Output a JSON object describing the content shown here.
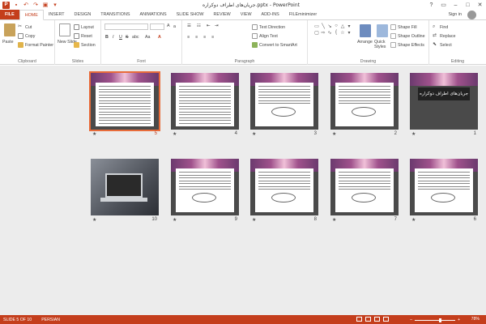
{
  "window": {
    "title": "جریان‌های اطراف دوکراره.pptx - PowerPoint",
    "minimize": "–",
    "maximize": "□",
    "close": "✕"
  },
  "tabs": [
    "FILE",
    "HOME",
    "INSERT",
    "DESIGN",
    "TRANSITIONS",
    "ANIMATIONS",
    "SLIDE SHOW",
    "REVIEW",
    "VIEW",
    "ADD-INS",
    "FILEminimizer"
  ],
  "account": {
    "signin": "Sign in"
  },
  "ribbon": {
    "clipboard": {
      "label": "Clipboard",
      "paste": "Paste",
      "cut": "Cut",
      "copy": "Copy",
      "format_painter": "Format Painter"
    },
    "slides": {
      "label": "Slides",
      "new_slide": "New Slide",
      "layout": "Layout",
      "reset": "Reset",
      "section": "Section"
    },
    "font": {
      "label": "Font",
      "bold": "B",
      "italic": "I",
      "underline": "U",
      "strike": "S",
      "shadow": "abc",
      "aa": "Aa"
    },
    "paragraph": {
      "label": "Paragraph",
      "text_direction": "Text Direction",
      "align_text": "Align Text",
      "convert_smartart": "Convert to SmartArt"
    },
    "drawing": {
      "label": "Drawing",
      "arrange": "Arrange",
      "quick_styles": "Quick Styles",
      "shape_fill": "Shape Fill",
      "shape_outline": "Shape Outline",
      "shape_effects": "Shape Effects"
    },
    "editing": {
      "label": "Editing",
      "find": "Find",
      "replace": "Replace",
      "select": "Select"
    }
  },
  "slides": [
    {
      "number": "1",
      "title": "جریان‌های اطراف دوکراره",
      "kind": "title"
    },
    {
      "number": "2",
      "kind": "diagram"
    },
    {
      "number": "3",
      "kind": "diagram"
    },
    {
      "number": "4",
      "kind": "text"
    },
    {
      "number": "5",
      "kind": "text",
      "selected": true
    },
    {
      "number": "6",
      "kind": "diagram"
    },
    {
      "number": "7",
      "kind": "diagram"
    },
    {
      "number": "8",
      "kind": "diagram"
    },
    {
      "number": "9",
      "kind": "diagram"
    },
    {
      "number": "10",
      "kind": "photo"
    }
  ],
  "status": {
    "slide_of": "SLIDE 5 OF 10",
    "language": "PERSIAN",
    "zoom": "78%"
  },
  "colors": {
    "accent": "#c43e1c",
    "selection": "#e86b3a"
  }
}
